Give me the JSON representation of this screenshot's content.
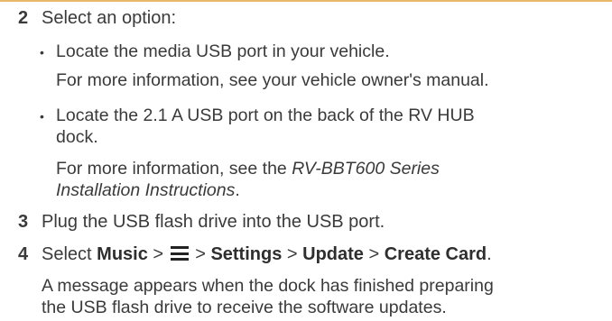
{
  "steps": {
    "step2": {
      "number": "2",
      "text": "Select an option:"
    },
    "bullet1": {
      "line1": "Locate the media USB port in your vehicle.",
      "note": "For more information, see your vehicle owner's manual."
    },
    "bullet2": {
      "line1": "Locate the 2.1 A USB port on the back of the RV HUB",
      "line2": "dock.",
      "note_prefix": "For more information, see the ",
      "note_title_part1": "RV-BBT600 Series",
      "note_title_part2": "Installation Instructions",
      "note_suffix": "."
    },
    "step3": {
      "number": "3",
      "text": "Plug the USB flash drive into the USB port."
    },
    "step4": {
      "number": "4",
      "prefix": "Select ",
      "music": "Music",
      "sep1": " > ",
      "menu_icon": "menu-icon",
      "sep2": " > ",
      "settings": "Settings",
      "sep3": " > ",
      "update": "Update",
      "sep4": " > ",
      "create_card": "Create Card",
      "suffix": "."
    },
    "result": {
      "line1": "A message appears when the dock has finished preparing",
      "line2": "the USB flash drive to receive the software updates."
    }
  },
  "bullet_char": "•"
}
